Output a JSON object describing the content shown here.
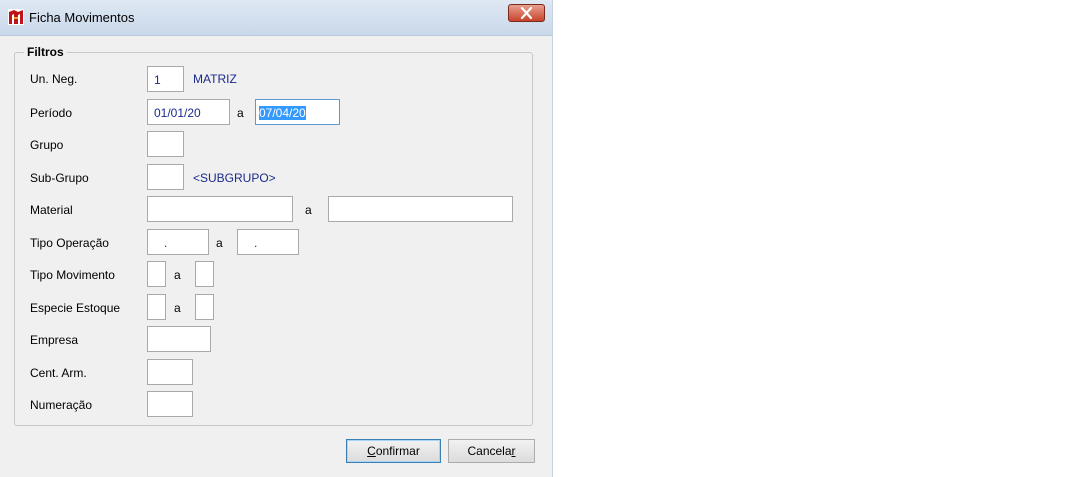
{
  "window": {
    "title": "Ficha Movimentos"
  },
  "filters": {
    "legend": "Filtros",
    "un_neg": {
      "label": "Un. Neg.",
      "value": "1",
      "name": "MATRIZ"
    },
    "periodo": {
      "label": "Período",
      "from": "01/01/20",
      "sep": "a",
      "to": "07/04/20"
    },
    "grupo": {
      "label": "Grupo",
      "value": ""
    },
    "sub_grupo": {
      "label": "Sub-Grupo",
      "value": "",
      "name": "<SUBGRUPO>"
    },
    "material": {
      "label": "Material",
      "from": "",
      "sep": "a",
      "to": ""
    },
    "tipo_operacao": {
      "label": "Tipo Operação",
      "from": ".",
      "sep": "a",
      "to": "."
    },
    "tipo_movimento": {
      "label": "Tipo Movimento",
      "from": "",
      "sep": "a",
      "to": ""
    },
    "especie_estoque": {
      "label": "Especie Estoque",
      "from": "",
      "sep": "a",
      "to": ""
    },
    "empresa": {
      "label": "Empresa",
      "value": ""
    },
    "cent_arm": {
      "label": "Cent. Arm.",
      "value": ""
    },
    "numeracao": {
      "label": "Numeração",
      "value": ""
    }
  },
  "buttons": {
    "confirm": {
      "prefix": "C",
      "rest": "onfirmar"
    },
    "cancel": {
      "prefix": "Cancela",
      "rest": "r"
    }
  }
}
